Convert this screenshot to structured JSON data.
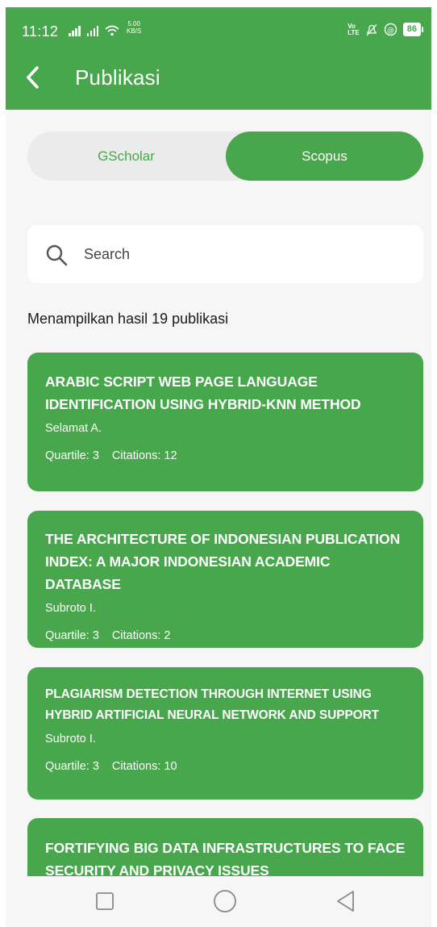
{
  "status_bar": {
    "time": "11:12",
    "net_speed_value": "5.00",
    "net_speed_unit": "KB/S",
    "volte_top": "Vo",
    "volte_bottom": "LTE",
    "battery": "86"
  },
  "app_bar": {
    "title": "Publikasi",
    "back_icon": "chevron-left-icon"
  },
  "tabs": {
    "items": [
      {
        "label": "GScholar",
        "selected": false
      },
      {
        "label": "Scopus",
        "selected": true
      }
    ]
  },
  "search": {
    "placeholder": "Search",
    "value": "",
    "icon": "search-icon"
  },
  "results": {
    "summary": "Menampilkan hasil 19 publikasi"
  },
  "publications": [
    {
      "title": "ARABIC SCRIPT WEB PAGE LANGUAGE IDENTIFICATION USING HYBRID-KNN METHOD",
      "author": "Selamat A.",
      "quartile": "Quartile: 3",
      "citations": "Citations: 12"
    },
    {
      "title": "THE ARCHITECTURE OF INDONESIAN PUBLICATION INDEX: A MAJOR INDONESIAN ACADEMIC DATABASE",
      "author": "Subroto I.",
      "quartile": "Quartile: 3",
      "citations": "Citations: 2"
    },
    {
      "title": "PLAGIARISM DETECTION THROUGH INTERNET USING HYBRID ARTIFICIAL NEURAL NETWORK AND SUPPORT",
      "author": "Subroto I.",
      "quartile": "Quartile: 3",
      "citations": "Citations: 10"
    },
    {
      "title": "FORTIFYING BIG DATA INFRASTRUCTURES TO FACE SECURITY AND PRIVACY ISSUES",
      "author": "",
      "quartile": "",
      "citations": ""
    }
  ],
  "nav_bar": {
    "icons": [
      "recents-square-icon",
      "home-circle-icon",
      "back-triangle-icon"
    ]
  },
  "colors": {
    "primary": "#48a74c",
    "background": "#f6f6f6",
    "segment_bg": "#ebebeb"
  }
}
